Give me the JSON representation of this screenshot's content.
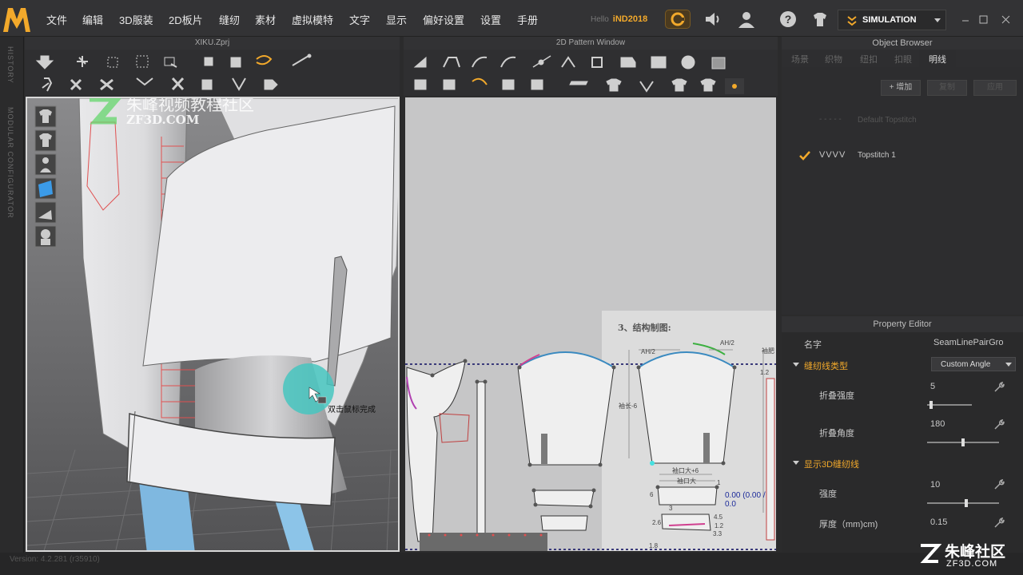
{
  "menubar": {
    "items": [
      "文件",
      "编辑",
      "3D服装",
      "2D板片",
      "缝纫",
      "素材",
      "虚拟模特",
      "文字",
      "显示",
      "偏好设置",
      "设置",
      "手册"
    ],
    "hello_label": "Hello",
    "user": "iND2018",
    "simulation": "SIMULATION"
  },
  "history_label": "HISTORY",
  "modular_label": "MODULAR CONFIGURATOR",
  "panel3d": {
    "title": "XIKU.Zprj",
    "watermark_text": "朱峰视频教程社区",
    "watermark_sub": "ZF3D.COM",
    "tooltip": "双击鼠标完成"
  },
  "panel2d": {
    "title": "2D Pattern Window",
    "ref_heading": "3、结构制图:",
    "labels": {
      "ah_left": "AH/2",
      "ah_right": "AH/2",
      "sleeve_len": "袖长-6",
      "cuff_left": "袖口大+6",
      "cuff_mid": "袖口大",
      "measure": "0.00 (0.00 / 0.0",
      "dim_45": "4.5",
      "dim_12": "1.2",
      "dim_33": "3.3",
      "dim_26": "2.6",
      "dim_6": "6",
      "dim_3": "3",
      "dim_1a": "1",
      "dim_18": "1.8",
      "side_cut": "袖肥",
      "side_12": "1.2"
    }
  },
  "object_browser": {
    "title": "Object Browser",
    "tabs": [
      "场景",
      "织物",
      "纽扣",
      "扣眼",
      "明线"
    ],
    "active_tab": "明线",
    "add_button": "+ 增加",
    "copy_button": "复制",
    "apply_button": "应用",
    "items": [
      {
        "name": "Default Topstitch",
        "pattern": "- - - - -",
        "checked": false
      },
      {
        "name": "Topstitch 1",
        "pattern": "VVVV",
        "checked": true
      }
    ]
  },
  "property_editor": {
    "title": "Property Editor",
    "name_label": "名字",
    "name_value": "SeamLinePairGro",
    "seam_type_section": "缝纫线类型",
    "seam_type_value": "Custom Angle",
    "fold_strength_label": "折叠强度",
    "fold_strength_value": "5",
    "fold_strength_level": 0.06,
    "fold_angle_label": "折叠角度",
    "fold_angle_value": "180",
    "fold_angle_level": 0.5,
    "show3d_section": "显示3D缝纫线",
    "strength_label": "强度",
    "strength_value": "10",
    "strength_level": 0.55,
    "thickness_label": "厚度（mm)cm)",
    "thickness_value": "0.15"
  },
  "status": {
    "version": "Version: 4.2.281 (r35910)",
    "brand": "朱峰社区",
    "brand_url": "ZF3D.COM"
  },
  "colors": {
    "accent": "#f2a92b",
    "teal": "#46c6c0",
    "seam_red": "#e05050",
    "seam_blue": "#4a7fc0"
  }
}
